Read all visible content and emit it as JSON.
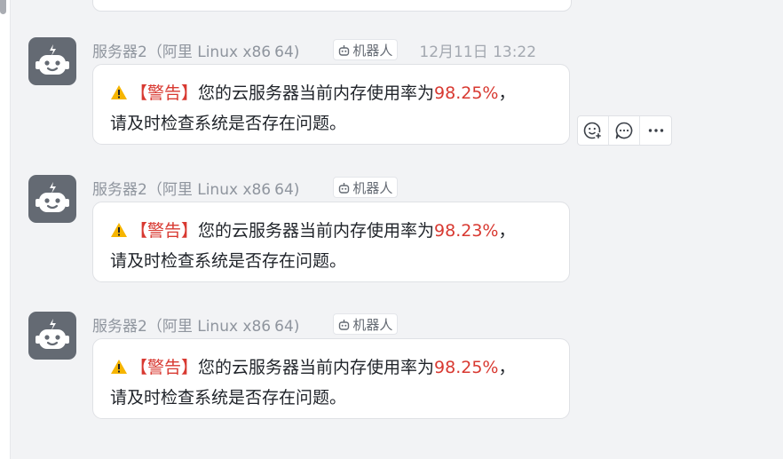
{
  "colors": {
    "warning_red": "#d83931",
    "avatar_bg": "#646a73",
    "warning_yellow": "#f6b500"
  },
  "messages": [
    {
      "sender": "服务器2（阿里 Linux x86",
      "sender_suffix": "64)",
      "tag": "机器人",
      "time": "12月11日 13:22",
      "warn_label": "【警告】",
      "text_before": "您的云服务器当前内存使用率为",
      "value": "98.25%",
      "text_after": "，",
      "line2": "请及时检查系统是否存在问题。"
    },
    {
      "sender": "服务器2（阿里 Linux x86",
      "sender_suffix": "64)",
      "tag": "机器人",
      "warn_label": "【警告】",
      "text_before": "您的云服务器当前内存使用率为",
      "value": "98.23%",
      "text_after": "，",
      "line2": "请及时检查系统是否存在问题。"
    },
    {
      "sender": "服务器2（阿里 Linux x86",
      "sender_suffix": "64)",
      "tag": "机器人",
      "warn_label": "【警告】",
      "text_before": "您的云服务器当前内存使用率为",
      "value": "98.25%",
      "text_after": "，",
      "line2": "请及时检查系统是否存在问题。"
    }
  ],
  "hover_actions": [
    "add-reaction-icon",
    "reply-icon",
    "more-icon"
  ]
}
